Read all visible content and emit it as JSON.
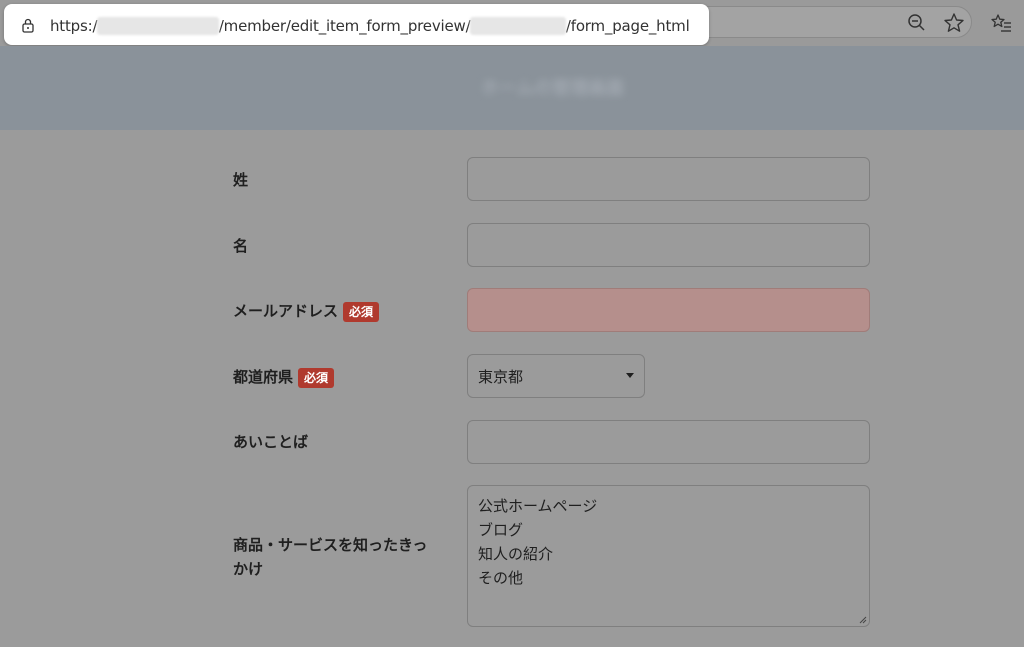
{
  "browser": {
    "url_prefix": "https:/",
    "url_blur1": "xxxxxxxxxxxxxx",
    "url_mid": "/member/edit_item_form_preview/",
    "url_blur2": "xxxxxxxxxxx",
    "url_suffix": "/form_page_html"
  },
  "header": {
    "title": "ホームの管理画面"
  },
  "form": {
    "required_badge": "必須",
    "fields": [
      {
        "label": "姓",
        "required": false,
        "type": "text",
        "value": ""
      },
      {
        "label": "名",
        "required": false,
        "type": "text",
        "value": ""
      },
      {
        "label": "メールアドレス",
        "required": true,
        "type": "text",
        "value": "",
        "error": true
      },
      {
        "label": "都道府県",
        "required": true,
        "type": "select",
        "value": "東京都"
      },
      {
        "label": "あいことば",
        "required": false,
        "type": "text",
        "value": ""
      },
      {
        "label_line1": "商品・サービスを知ったきっ",
        "label_line2": "かけ",
        "required": false,
        "type": "textarea",
        "options": [
          "公式ホームページ",
          "ブログ",
          "知人の紹介",
          "その他"
        ]
      }
    ]
  },
  "colors": {
    "required_badge": "#b03a2e",
    "error_input_bg": "#b58f8c",
    "overlay_gray": "#9b9b9b",
    "header_bg": "#8a929a"
  },
  "icons": {
    "lock": "lock-icon",
    "zoom": "zoom-out-icon",
    "star": "star-icon",
    "favorites": "favorites-icon",
    "caret": "caret-down-icon",
    "resize": "resize-handle-icon"
  }
}
